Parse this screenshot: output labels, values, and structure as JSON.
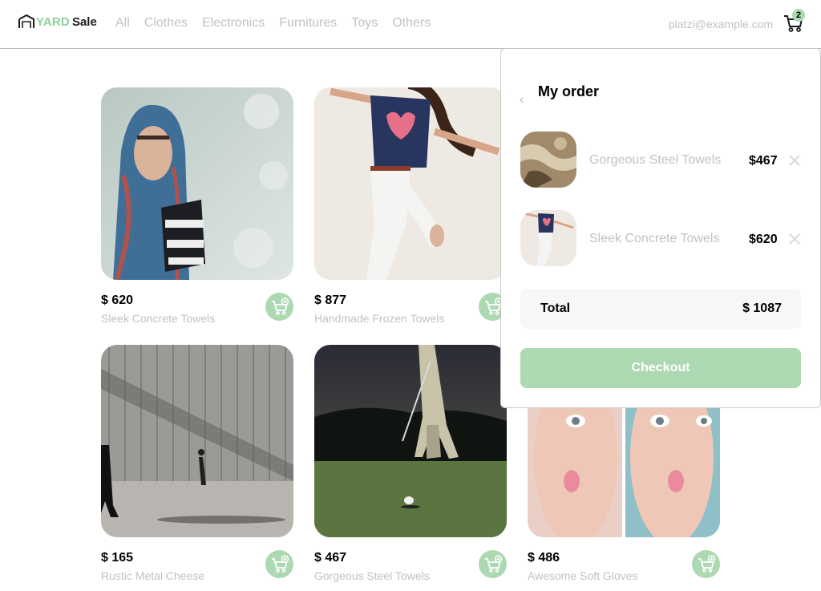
{
  "brand": {
    "yard": "YARD",
    "sale": "Sale",
    "accent": "#acd9b2"
  },
  "nav": {
    "links": [
      "All",
      "Clothes",
      "Electronics",
      "Furnitures",
      "Toys",
      "Others"
    ]
  },
  "user": {
    "email": "platzi@example.com"
  },
  "cart": {
    "count": "2",
    "icon": "shopping-cart-icon"
  },
  "products": [
    {
      "price": "$ 620",
      "name": "Sleek Concrete Towels",
      "image": "woman-in-scarf-photo"
    },
    {
      "price": "$ 877",
      "name": "Handmade Frozen Towels",
      "image": "woman-jumping-photo"
    },
    {
      "price": "$ 165",
      "name": "Rustic Metal Cheese",
      "image": "street-wall-photo"
    },
    {
      "price": "$ 467",
      "name": "Gorgeous Steel Towels",
      "image": "golfer-night-photo"
    },
    {
      "price": "$ 486",
      "name": "Awesome Soft Gloves",
      "image": "woman-faces-photo"
    }
  ],
  "order": {
    "title": "My order",
    "items": [
      {
        "name": "Gorgeous Steel Towels",
        "price": "$467",
        "image": "aerial-terrain-photo"
      },
      {
        "name": "Sleek Concrete Towels",
        "price": "$620",
        "image": "woman-jumping-photo"
      }
    ],
    "total_label": "Total",
    "total_value": "$ 1087",
    "checkout_label": "Checkout"
  }
}
